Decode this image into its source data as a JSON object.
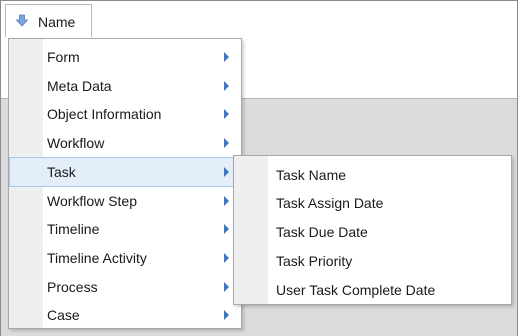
{
  "header": {
    "column_label": "Name",
    "sort_icon": "arrow-down-icon"
  },
  "main_menu": {
    "items": [
      {
        "label": "Form",
        "has_submenu": true
      },
      {
        "label": "Meta Data",
        "has_submenu": true
      },
      {
        "label": "Object Information",
        "has_submenu": true
      },
      {
        "label": "Workflow",
        "has_submenu": true
      },
      {
        "label": "Task",
        "has_submenu": true,
        "highlighted": true
      },
      {
        "label": "Workflow Step",
        "has_submenu": true
      },
      {
        "label": "Timeline",
        "has_submenu": true
      },
      {
        "label": "Timeline Activity",
        "has_submenu": true
      },
      {
        "label": "Process",
        "has_submenu": true
      },
      {
        "label": "Case",
        "has_submenu": true
      }
    ]
  },
  "sub_menu": {
    "items": [
      {
        "label": "Task Name"
      },
      {
        "label": "Task Assign Date"
      },
      {
        "label": "Task Due Date"
      },
      {
        "label": "Task Priority"
      },
      {
        "label": "User Task Complete Date"
      }
    ]
  },
  "colors": {
    "highlight": "#e4eefb",
    "highlight_border": "#aac8ec",
    "arrow": "#3c78c4",
    "gutter": "#efefef",
    "background_area": "#dcdcdc"
  }
}
